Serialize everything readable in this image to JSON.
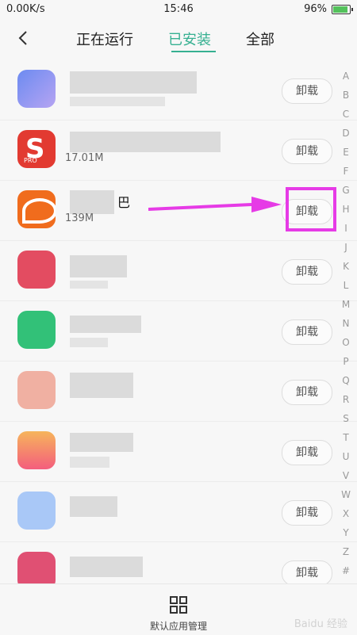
{
  "status": {
    "left": "0.00K/s",
    "time": "15:46",
    "battery": "96%",
    "battery_level": 0.96
  },
  "tabs": [
    "正在运行",
    "已安装",
    "全部"
  ],
  "active_tab_index": 1,
  "list": [
    {
      "name": "",
      "size": "",
      "uninstall_label": "卸载"
    },
    {
      "name": "",
      "size": "17.01M",
      "uninstall_label": "卸载"
    },
    {
      "name": "巴",
      "size": "139M",
      "uninstall_label": "卸载"
    },
    {
      "name": "",
      "size": "",
      "uninstall_label": "卸载"
    },
    {
      "name": "",
      "size": "",
      "uninstall_label": "卸载"
    },
    {
      "name": "",
      "size": "",
      "uninstall_label": "卸载"
    },
    {
      "name": "",
      "size": "",
      "uninstall_label": "卸载"
    },
    {
      "name": "",
      "size": "",
      "uninstall_label": "卸载"
    },
    {
      "name": "",
      "size": "",
      "uninstall_label": "卸载"
    }
  ],
  "alphabet": [
    "A",
    "B",
    "C",
    "D",
    "E",
    "F",
    "G",
    "H",
    "I",
    "J",
    "K",
    "L",
    "M",
    "N",
    "O",
    "P",
    "Q",
    "R",
    "S",
    "T",
    "U",
    "V",
    "W",
    "X",
    "Y",
    "Z",
    "#"
  ],
  "bottom_label": "默认应用管理",
  "watermark": "Baidu 经验",
  "colors": {
    "accent": "#36b091",
    "annotation": "#e63be6"
  }
}
